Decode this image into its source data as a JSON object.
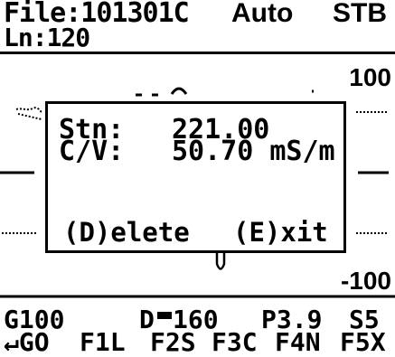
{
  "header": {
    "file": "File:101301C",
    "mode": "Auto",
    "status": "STB",
    "line": "Ln:120"
  },
  "plot": {
    "y_max_label": "100",
    "y_min_label": "-100"
  },
  "dialog": {
    "station_label": "Stn:",
    "station_value": "221.00",
    "cv_label": "C/V:",
    "cv_value": "50.70 mS/m",
    "delete_label": "(D)elete",
    "exit_label": "(E)xit"
  },
  "status_bar": {
    "gain": "G100",
    "distance_prefix": "D",
    "distance_value": "160",
    "p_value": "P3.9",
    "s_value": "S5"
  },
  "function_keys": {
    "enter": "↵GO",
    "f1": "F1L",
    "f2": "F2S",
    "f3": "F3C",
    "f4": "F4N",
    "f5": "F5X"
  },
  "colors": {
    "foreground": "#000000",
    "background": "#ffffff"
  }
}
